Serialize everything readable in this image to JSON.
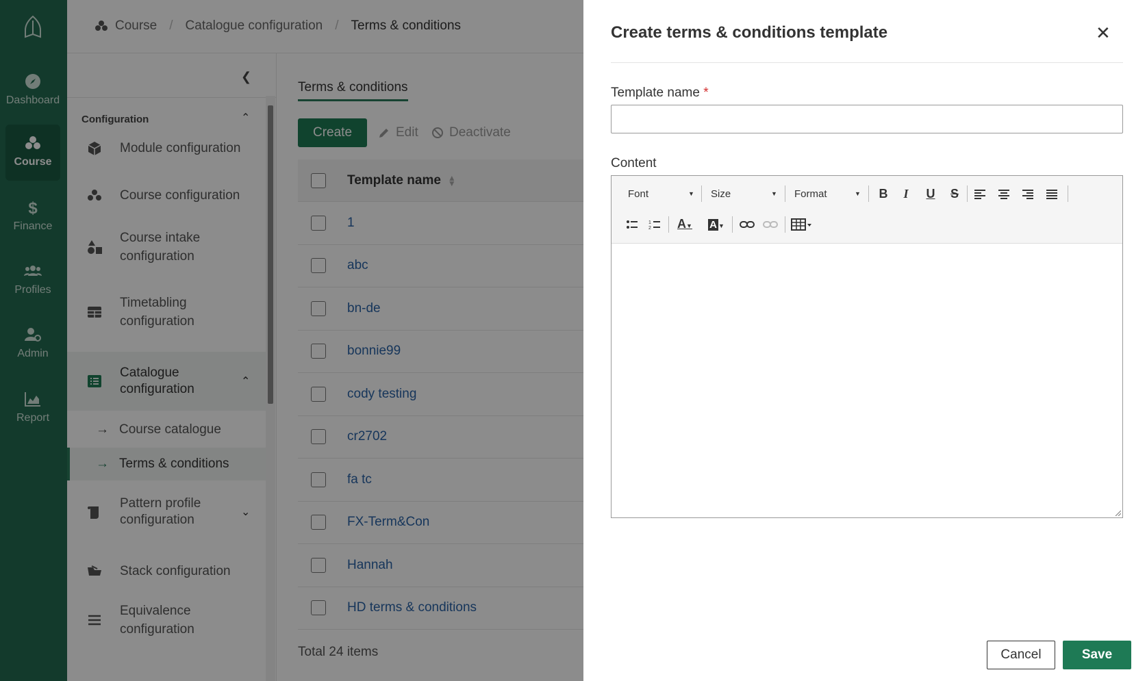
{
  "rail": {
    "items": [
      {
        "label": "Dashboard",
        "icon": "compass-icon"
      },
      {
        "label": "Course",
        "icon": "blocks-icon",
        "active": true
      },
      {
        "label": "Finance",
        "icon": "dollar-icon"
      },
      {
        "label": "Profiles",
        "icon": "users-icon"
      },
      {
        "label": "Admin",
        "icon": "user-gear-icon"
      },
      {
        "label": "Report",
        "icon": "area-chart-icon"
      }
    ]
  },
  "breadcrumb": [
    "Course",
    "Catalogue configuration",
    "Terms & conditions"
  ],
  "subnav": {
    "section_title": "Configuration",
    "items": [
      {
        "label": "Module configuration"
      },
      {
        "label": "Course configuration"
      },
      {
        "label": "Course intake configuration"
      },
      {
        "label": "Timetabling configuration"
      },
      {
        "label": "Catalogue configuration"
      },
      {
        "label": "Pattern profile configuration"
      },
      {
        "label": "Stack configuration"
      },
      {
        "label": "Equivalence configuration"
      }
    ],
    "sub_items": [
      {
        "label": "Course catalogue"
      },
      {
        "label": "Terms & conditions",
        "active": true
      }
    ]
  },
  "main": {
    "tab": "Terms & conditions",
    "toolbar": {
      "create": "Create",
      "edit": "Edit",
      "deactivate": "Deactivate"
    },
    "table": {
      "header": "Template name",
      "rows": [
        "1",
        "abc",
        "bn-de",
        "bonnie99",
        "cody testing",
        "cr2702",
        "fa tc",
        "FX-Term&Con",
        "Hannah",
        "HD terms & conditions"
      ]
    },
    "total": "Total 24 items"
  },
  "drawer": {
    "title": "Create terms & conditions template",
    "name_label": "Template name",
    "required_mark": "*",
    "name_value": "",
    "content_label": "Content",
    "toolbar": {
      "font": "Font",
      "size": "Size",
      "format": "Format"
    },
    "cancel": "Cancel",
    "save": "Save"
  },
  "colors": {
    "brand": "#236b51",
    "primary_button": "#1e7a55",
    "link": "#2a63a6",
    "required": "#d32f2f"
  }
}
